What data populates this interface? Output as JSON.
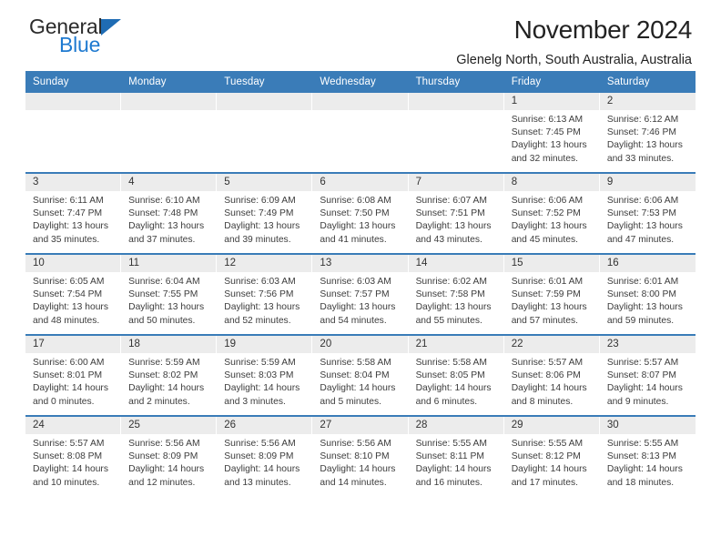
{
  "brand": {
    "name_part1": "General",
    "name_part2": "Blue",
    "flag_icon": "triangle-flag-icon",
    "accent_color": "#1f7ad0"
  },
  "header": {
    "title": "November 2024",
    "location": "Glenelg North, South Australia, Australia"
  },
  "theme": {
    "header_blue": "#3a7cb8",
    "day_strip_gray": "#ececec",
    "text": "#3c3c3c"
  },
  "calendar": {
    "weekdays": [
      "Sunday",
      "Monday",
      "Tuesday",
      "Wednesday",
      "Thursday",
      "Friday",
      "Saturday"
    ],
    "weeks": [
      [
        {
          "day": "",
          "empty": true
        },
        {
          "day": "",
          "empty": true
        },
        {
          "day": "",
          "empty": true
        },
        {
          "day": "",
          "empty": true
        },
        {
          "day": "",
          "empty": true
        },
        {
          "day": "1",
          "sunrise": "Sunrise: 6:13 AM",
          "sunset": "Sunset: 7:45 PM",
          "daylight": "Daylight: 13 hours and 32 minutes."
        },
        {
          "day": "2",
          "sunrise": "Sunrise: 6:12 AM",
          "sunset": "Sunset: 7:46 PM",
          "daylight": "Daylight: 13 hours and 33 minutes."
        }
      ],
      [
        {
          "day": "3",
          "sunrise": "Sunrise: 6:11 AM",
          "sunset": "Sunset: 7:47 PM",
          "daylight": "Daylight: 13 hours and 35 minutes."
        },
        {
          "day": "4",
          "sunrise": "Sunrise: 6:10 AM",
          "sunset": "Sunset: 7:48 PM",
          "daylight": "Daylight: 13 hours and 37 minutes."
        },
        {
          "day": "5",
          "sunrise": "Sunrise: 6:09 AM",
          "sunset": "Sunset: 7:49 PM",
          "daylight": "Daylight: 13 hours and 39 minutes."
        },
        {
          "day": "6",
          "sunrise": "Sunrise: 6:08 AM",
          "sunset": "Sunset: 7:50 PM",
          "daylight": "Daylight: 13 hours and 41 minutes."
        },
        {
          "day": "7",
          "sunrise": "Sunrise: 6:07 AM",
          "sunset": "Sunset: 7:51 PM",
          "daylight": "Daylight: 13 hours and 43 minutes."
        },
        {
          "day": "8",
          "sunrise": "Sunrise: 6:06 AM",
          "sunset": "Sunset: 7:52 PM",
          "daylight": "Daylight: 13 hours and 45 minutes."
        },
        {
          "day": "9",
          "sunrise": "Sunrise: 6:06 AM",
          "sunset": "Sunset: 7:53 PM",
          "daylight": "Daylight: 13 hours and 47 minutes."
        }
      ],
      [
        {
          "day": "10",
          "sunrise": "Sunrise: 6:05 AM",
          "sunset": "Sunset: 7:54 PM",
          "daylight": "Daylight: 13 hours and 48 minutes."
        },
        {
          "day": "11",
          "sunrise": "Sunrise: 6:04 AM",
          "sunset": "Sunset: 7:55 PM",
          "daylight": "Daylight: 13 hours and 50 minutes."
        },
        {
          "day": "12",
          "sunrise": "Sunrise: 6:03 AM",
          "sunset": "Sunset: 7:56 PM",
          "daylight": "Daylight: 13 hours and 52 minutes."
        },
        {
          "day": "13",
          "sunrise": "Sunrise: 6:03 AM",
          "sunset": "Sunset: 7:57 PM",
          "daylight": "Daylight: 13 hours and 54 minutes."
        },
        {
          "day": "14",
          "sunrise": "Sunrise: 6:02 AM",
          "sunset": "Sunset: 7:58 PM",
          "daylight": "Daylight: 13 hours and 55 minutes."
        },
        {
          "day": "15",
          "sunrise": "Sunrise: 6:01 AM",
          "sunset": "Sunset: 7:59 PM",
          "daylight": "Daylight: 13 hours and 57 minutes."
        },
        {
          "day": "16",
          "sunrise": "Sunrise: 6:01 AM",
          "sunset": "Sunset: 8:00 PM",
          "daylight": "Daylight: 13 hours and 59 minutes."
        }
      ],
      [
        {
          "day": "17",
          "sunrise": "Sunrise: 6:00 AM",
          "sunset": "Sunset: 8:01 PM",
          "daylight": "Daylight: 14 hours and 0 minutes."
        },
        {
          "day": "18",
          "sunrise": "Sunrise: 5:59 AM",
          "sunset": "Sunset: 8:02 PM",
          "daylight": "Daylight: 14 hours and 2 minutes."
        },
        {
          "day": "19",
          "sunrise": "Sunrise: 5:59 AM",
          "sunset": "Sunset: 8:03 PM",
          "daylight": "Daylight: 14 hours and 3 minutes."
        },
        {
          "day": "20",
          "sunrise": "Sunrise: 5:58 AM",
          "sunset": "Sunset: 8:04 PM",
          "daylight": "Daylight: 14 hours and 5 minutes."
        },
        {
          "day": "21",
          "sunrise": "Sunrise: 5:58 AM",
          "sunset": "Sunset: 8:05 PM",
          "daylight": "Daylight: 14 hours and 6 minutes."
        },
        {
          "day": "22",
          "sunrise": "Sunrise: 5:57 AM",
          "sunset": "Sunset: 8:06 PM",
          "daylight": "Daylight: 14 hours and 8 minutes."
        },
        {
          "day": "23",
          "sunrise": "Sunrise: 5:57 AM",
          "sunset": "Sunset: 8:07 PM",
          "daylight": "Daylight: 14 hours and 9 minutes."
        }
      ],
      [
        {
          "day": "24",
          "sunrise": "Sunrise: 5:57 AM",
          "sunset": "Sunset: 8:08 PM",
          "daylight": "Daylight: 14 hours and 10 minutes."
        },
        {
          "day": "25",
          "sunrise": "Sunrise: 5:56 AM",
          "sunset": "Sunset: 8:09 PM",
          "daylight": "Daylight: 14 hours and 12 minutes."
        },
        {
          "day": "26",
          "sunrise": "Sunrise: 5:56 AM",
          "sunset": "Sunset: 8:09 PM",
          "daylight": "Daylight: 14 hours and 13 minutes."
        },
        {
          "day": "27",
          "sunrise": "Sunrise: 5:56 AM",
          "sunset": "Sunset: 8:10 PM",
          "daylight": "Daylight: 14 hours and 14 minutes."
        },
        {
          "day": "28",
          "sunrise": "Sunrise: 5:55 AM",
          "sunset": "Sunset: 8:11 PM",
          "daylight": "Daylight: 14 hours and 16 minutes."
        },
        {
          "day": "29",
          "sunrise": "Sunrise: 5:55 AM",
          "sunset": "Sunset: 8:12 PM",
          "daylight": "Daylight: 14 hours and 17 minutes."
        },
        {
          "day": "30",
          "sunrise": "Sunrise: 5:55 AM",
          "sunset": "Sunset: 8:13 PM",
          "daylight": "Daylight: 14 hours and 18 minutes."
        }
      ]
    ]
  }
}
